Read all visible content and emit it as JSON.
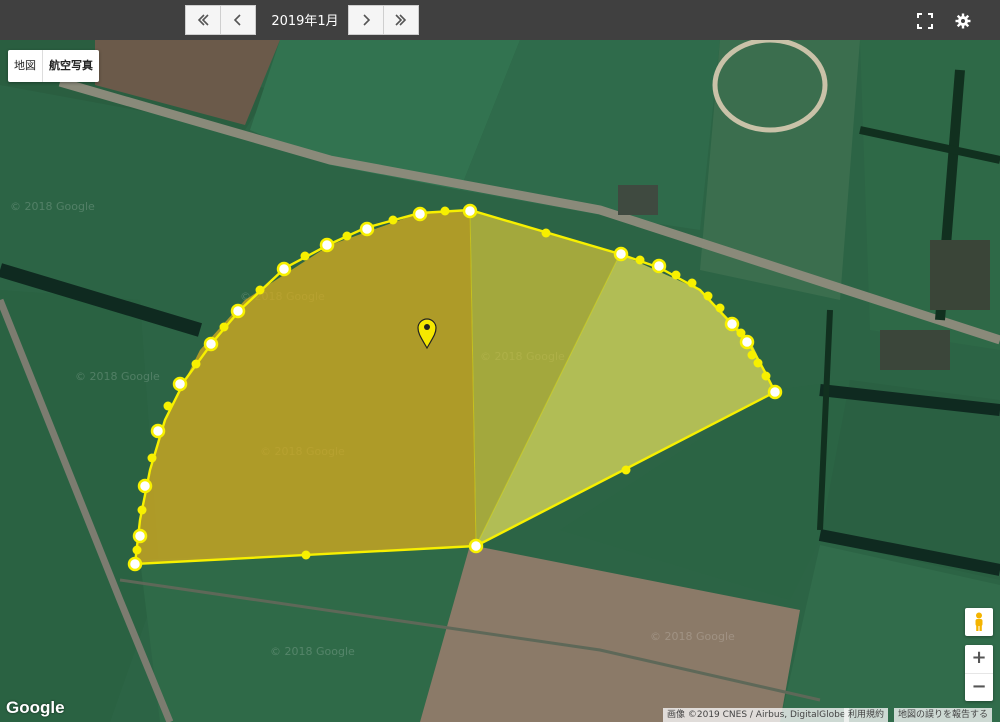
{
  "toolbar": {
    "date": "2019年1月",
    "buttons": [
      "first-page",
      "previous",
      "next",
      "last-page"
    ]
  },
  "map_type": {
    "map_label": "地図",
    "satellite_label": "航空写真"
  },
  "attribution": {
    "imagery": "画像 ©2019 CNES / Airbus, DigitalGlobe",
    "terms": "利用規約",
    "report": "地図の誤りを報告する"
  },
  "watermark_text": "© 2018 Google",
  "logo": "Google",
  "zoom": {
    "in": "+",
    "out": "−"
  },
  "colors": {
    "polygon_stroke": "#f7f000",
    "polygon_fill": "#e8d800",
    "marker": "#f6e800"
  }
}
